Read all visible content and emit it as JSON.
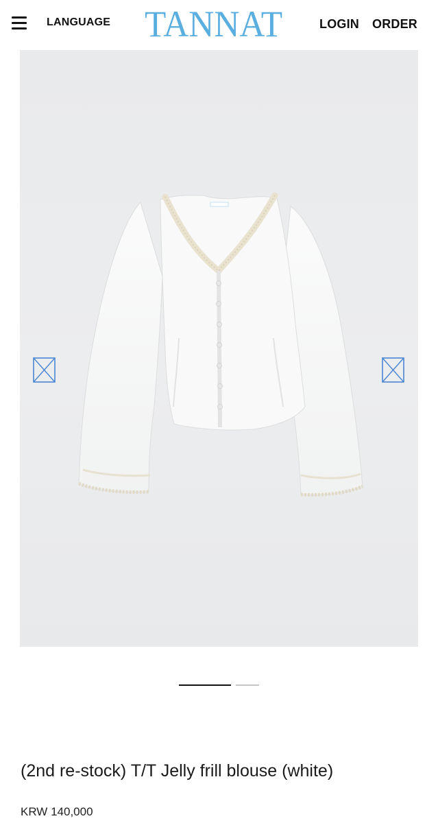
{
  "header": {
    "language_label": "LANGUAGE",
    "logo_text": "TANNAT",
    "login_label": "LOGIN",
    "order_label": "ORDER",
    "logo_color": "#5aaee0"
  },
  "gallery": {
    "image_description_icon": "product-photo",
    "prev_icon": "broken-image-arrow-icon",
    "next_icon": "broken-image-arrow-icon",
    "slides_total": 2,
    "active_slide": 1
  },
  "product": {
    "name": "(2nd re-stock) T/T Jelly frill blouse (white)",
    "price": "KRW 140,000"
  }
}
